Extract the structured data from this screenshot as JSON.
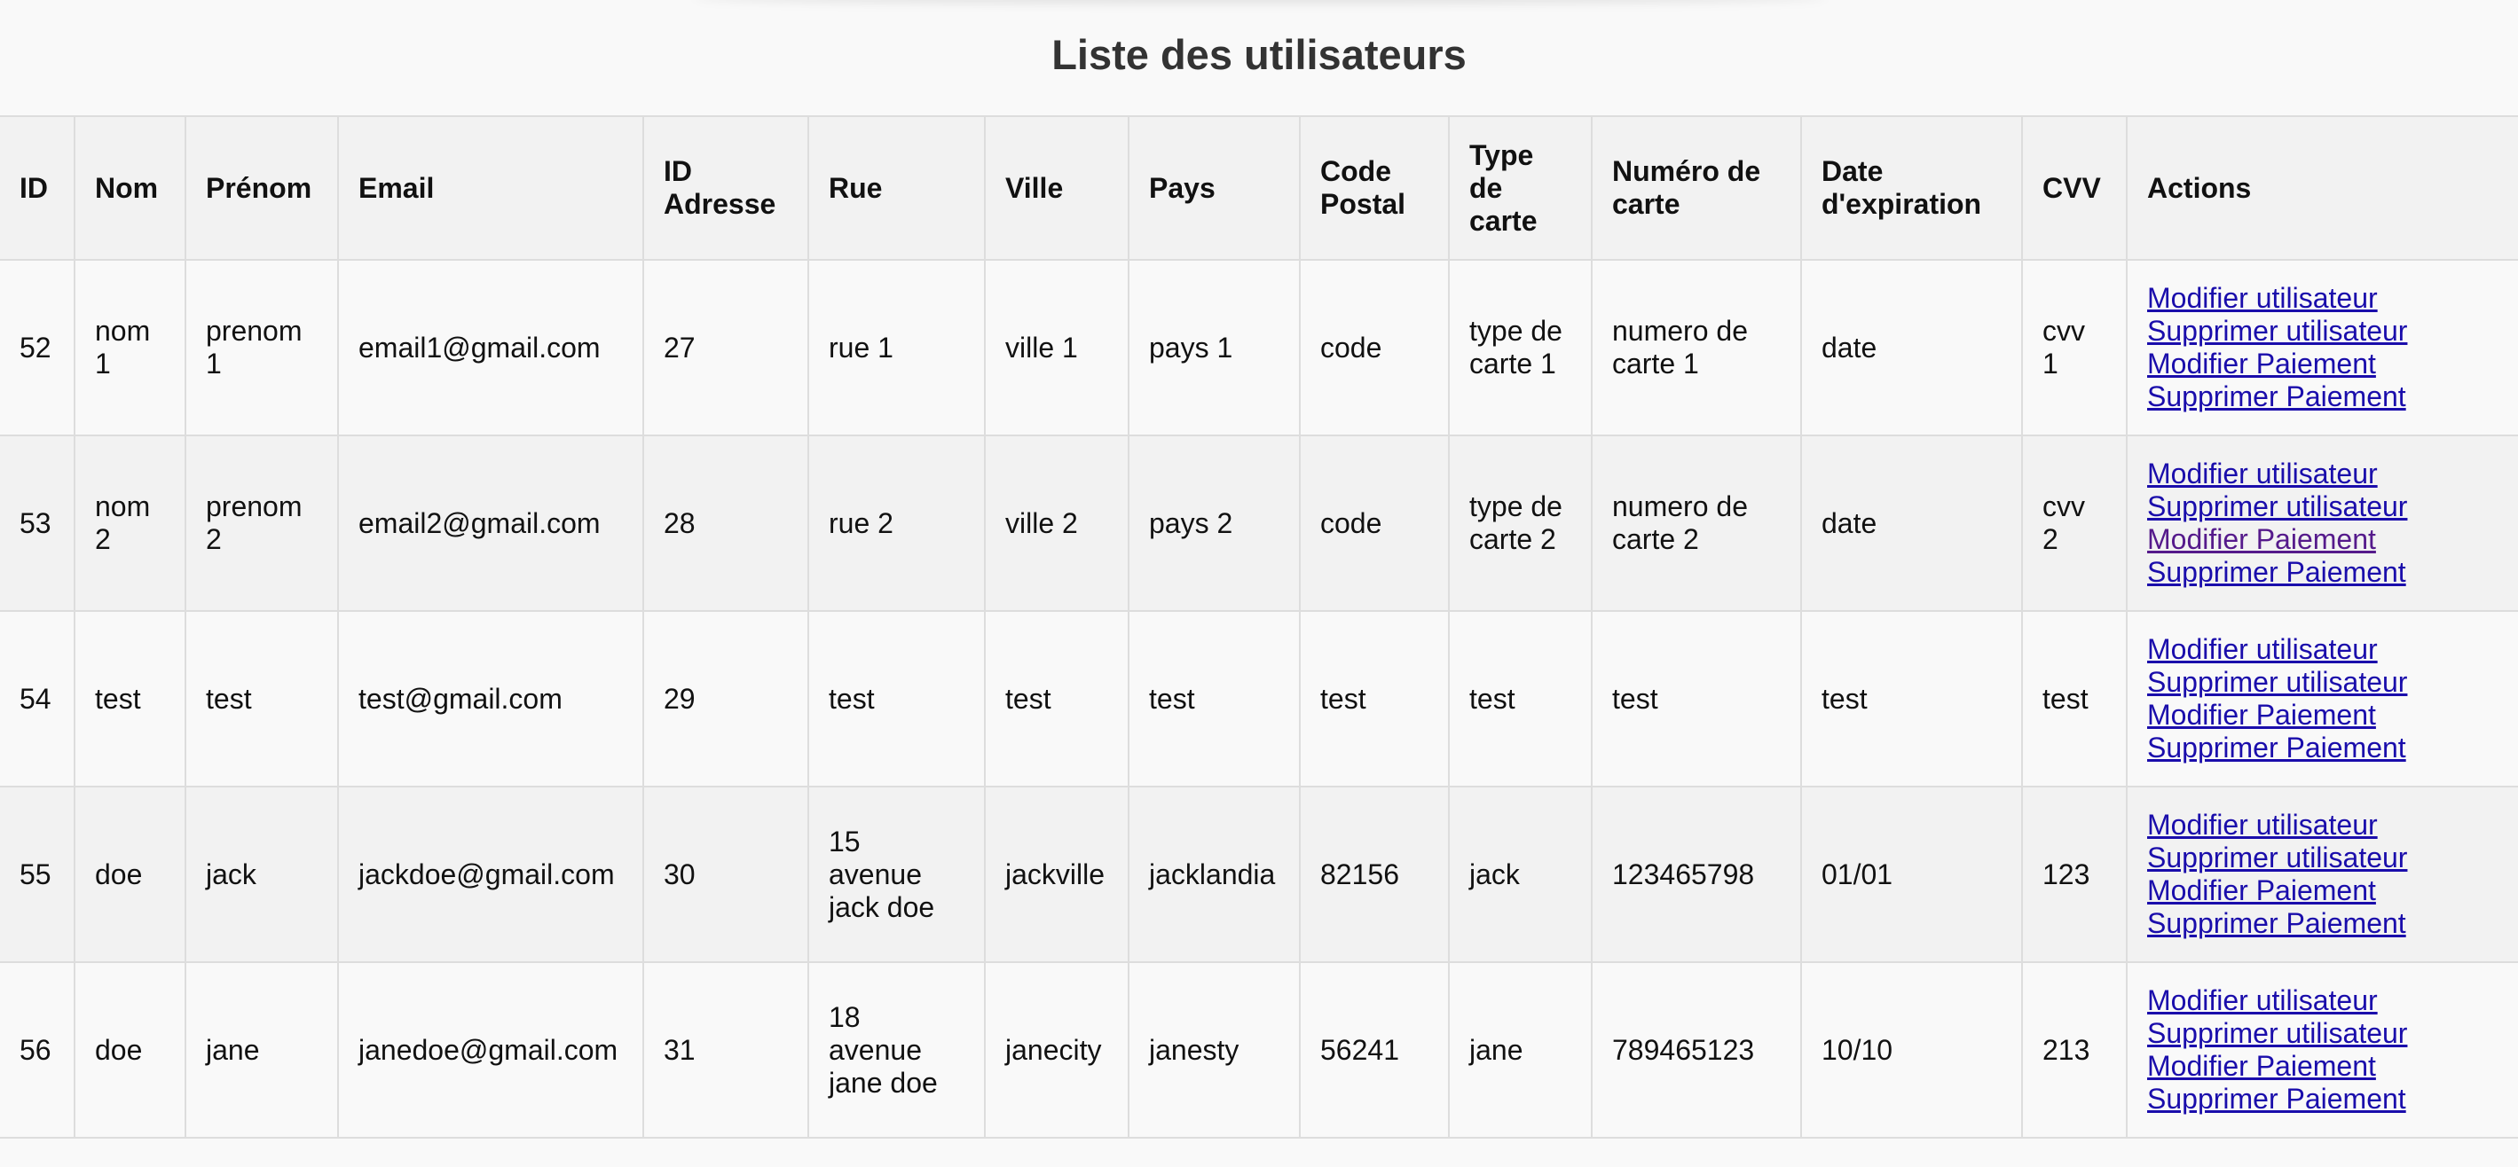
{
  "page": {
    "title": "Liste des utilisateurs"
  },
  "table": {
    "headers": [
      "ID",
      "Nom",
      "Prénom",
      "Email",
      "ID Adresse",
      "Rue",
      "Ville",
      "Pays",
      "Code Postal",
      "Type de carte",
      "Numéro de carte",
      "Date d'expiration",
      "CVV",
      "Actions"
    ],
    "action_labels": {
      "edit_user": "Modifier utilisateur",
      "delete_user": "Supprimer utilisateur",
      "edit_payment": "Modifier Paiement",
      "delete_payment": "Supprimer Paiement"
    },
    "rows": [
      [
        "52",
        "nom 1",
        "prenom 1",
        "email1@gmail.com",
        "27",
        "rue 1",
        "ville 1",
        "pays 1",
        "code",
        "type de carte 1",
        "numero de carte 1",
        "date",
        "cvv 1"
      ],
      [
        "53",
        "nom 2",
        "prenom 2",
        "email2@gmail.com",
        "28",
        "rue 2",
        "ville 2",
        "pays 2",
        "code",
        "type de carte 2",
        "numero de carte 2",
        "date",
        "cvv 2"
      ],
      [
        "54",
        "test",
        "test",
        "test@gmail.com",
        "29",
        "test",
        "test",
        "test",
        "test",
        "test",
        "test",
        "test",
        "test"
      ],
      [
        "55",
        "doe",
        "jack",
        "jackdoe@gmail.com",
        "30",
        "15 avenue jack doe",
        "jackville",
        "jacklandia",
        "82156",
        "jack",
        "123465798",
        "01/01",
        "123"
      ],
      [
        "56",
        "doe",
        "jane",
        "janedoe@gmail.com",
        "31",
        "18 avenue jane doe",
        "janecity",
        "janesty",
        "56241",
        "jane",
        "789465123",
        "10/10",
        "213"
      ]
    ]
  }
}
